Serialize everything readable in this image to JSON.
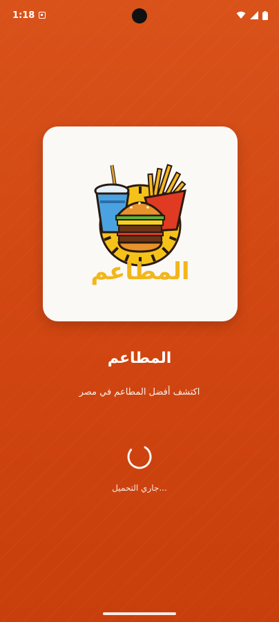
{
  "status_bar": {
    "time": "1:18",
    "notification_icon": "notification-icon",
    "wifi_icon": "wifi-icon",
    "signal_icon": "signal-icon",
    "battery_icon": "battery-icon"
  },
  "logo": {
    "wordmark": "المطاعم",
    "icon": "burger-fries-drink-logo"
  },
  "app": {
    "title": "المطاعم",
    "subtitle": "اكتشف أفضل المطاعم في مصر"
  },
  "loading": {
    "text": "...جاري التحميل"
  },
  "colors": {
    "background": "#d4470f",
    "card": "#fbf9f6",
    "wordmark": "#f2b61b"
  }
}
